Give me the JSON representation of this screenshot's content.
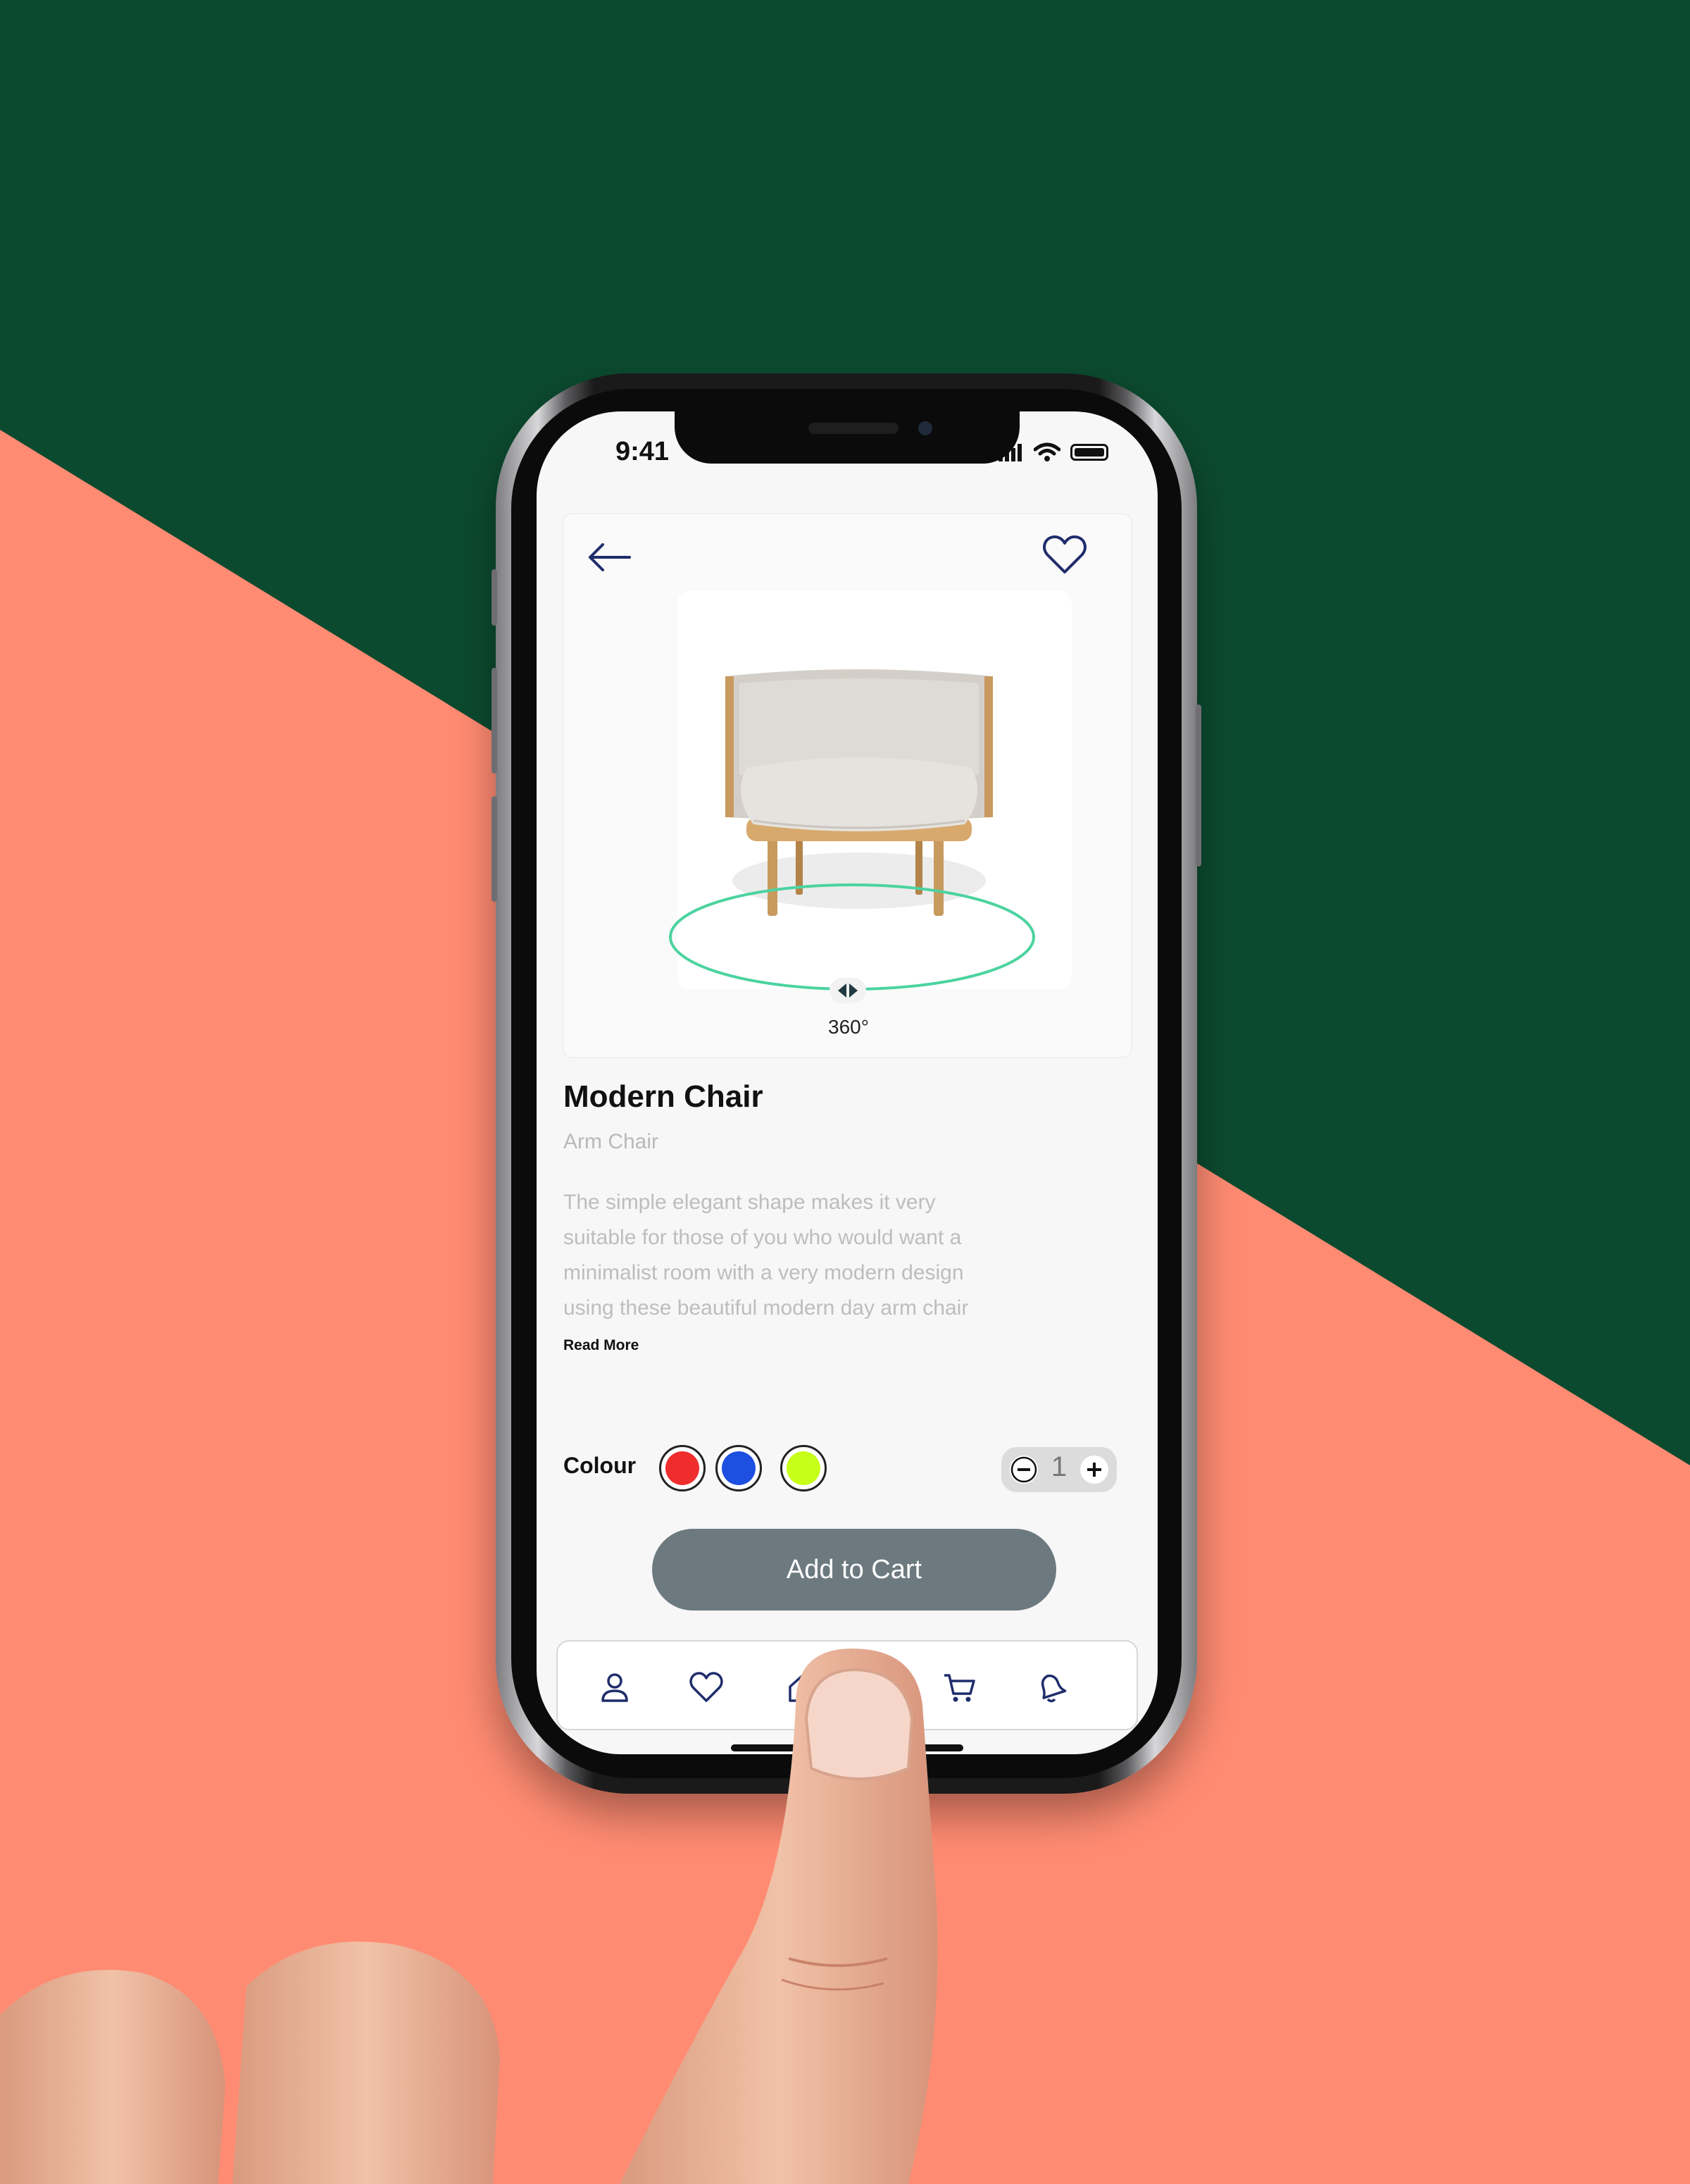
{
  "colors": {
    "background_green": "#0c4a2f",
    "background_coral": "#ff8b72",
    "accent_navy": "#1f2d6b",
    "button_gray": "#6c7a80",
    "ring_teal": "#4cd3a0"
  },
  "status_bar": {
    "time": "9:41"
  },
  "top_bar": {
    "back_icon": "arrow-left-icon",
    "favorite_icon": "heart-icon"
  },
  "product": {
    "image": "armchair-image",
    "rotation_label": "360°",
    "name": "Modern Chair",
    "category": "Arm Chair",
    "description_lines": [
      "The simple elegant shape makes it very",
      "suitable for those of you who would want a",
      "minimalist room with a very modern design",
      "using these beautiful modern day arm chair"
    ],
    "read_more": "Read More"
  },
  "options": {
    "colour_label": "Colour",
    "swatches": [
      "#ef2d2d",
      "#1d4fe0",
      "#c7ff1a"
    ],
    "quantity": "1"
  },
  "actions": {
    "add_to_cart": "Add to Cart"
  },
  "tab_bar": {
    "tabs": [
      "profile-icon",
      "heart-icon",
      "home-icon",
      "cart-icon",
      "bell-icon"
    ]
  }
}
